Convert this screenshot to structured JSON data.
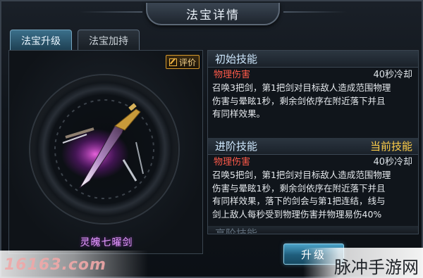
{
  "window": {
    "title": "法宝详情"
  },
  "tabs": [
    {
      "label": "法宝升级",
      "active": true
    },
    {
      "label": "法宝加持",
      "active": false
    }
  ],
  "left": {
    "rate_label": "评价",
    "weapon_name": "灵魄七曜剑",
    "weapon_color": "#e59cff"
  },
  "skills": {
    "initial": {
      "heading": "初始技能",
      "type": "物理伤害",
      "cooldown": "40秒冷却",
      "desc": [
        "召唤3把剑，第1把剑对目标敌人造成范围物理",
        "伤害与晕眩1秒，剩余剑依序在附近落下并且",
        "有同样效果。"
      ]
    },
    "advanced": {
      "heading": "进阶技能",
      "current_label": "当前技能",
      "type": "物理伤害",
      "cooldown": "40秒冷却",
      "desc": [
        "召唤5把剑，第1把剑对目标敌人造成范围物理",
        "伤害与晕眩1秒，剩余剑依序在附近落下并且",
        "有同样效果，落下的剑会与第1把连结，线与",
        "剑上敌人每秒受到物理伤害并物理易伤40%"
      ]
    },
    "next": {
      "heading": "高阶技能"
    }
  },
  "upgrade_label": "升级",
  "watermarks": {
    "left": "16163.com",
    "right": "脉冲手游网"
  },
  "colors": {
    "damage_type": "#ff5a4a",
    "current_skill": "#ffcf4a",
    "accent": "#4aa3c9"
  },
  "icons": [
    "edit-icon"
  ]
}
